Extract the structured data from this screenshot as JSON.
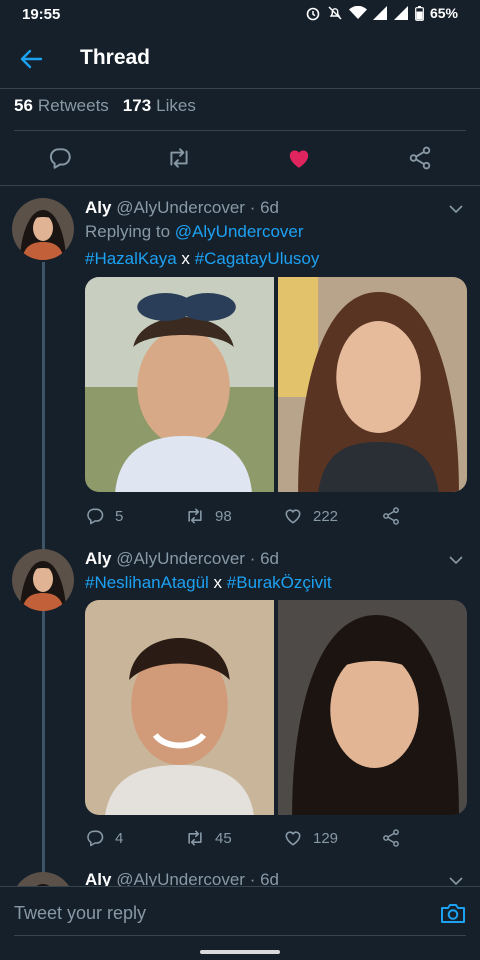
{
  "status_bar": {
    "time": "19:55",
    "battery": "65%"
  },
  "header": {
    "title": "Thread"
  },
  "stats": {
    "retweets_count": "56",
    "retweets_label": "Retweets",
    "likes_count": "173",
    "likes_label": "Likes"
  },
  "colors": {
    "background": "#15202b",
    "accent": "#1da1f2",
    "like": "#e0245e",
    "muted": "#8899a6",
    "divider": "#38444d"
  },
  "tweets": [
    {
      "name": "Aly",
      "handle": "@AlyUndercover",
      "time": "· 6d",
      "replying_label": "Replying to",
      "replying_to": "@AlyUndercover",
      "hashtag_1": "#HazalKaya",
      "separator": "x",
      "hashtag_2": "#CagatayUlusoy",
      "replies": "5",
      "retweets": "98",
      "likes": "222"
    },
    {
      "name": "Aly",
      "handle": "@AlyUndercover",
      "time": "· 6d",
      "hashtag_1": "#NeslihanAtagül",
      "separator": "x",
      "hashtag_2": "#BurakÖzçivit",
      "replies": "4",
      "retweets": "45",
      "likes": "129"
    },
    {
      "name": "Aly",
      "handle": "@AlyUndercover",
      "time": "· 6d"
    }
  ],
  "reply_box": {
    "placeholder": "Tweet your reply"
  },
  "icons": [
    "back-arrow-icon",
    "reply-icon",
    "retweet-icon",
    "heart-icon",
    "share-icon",
    "chevron-down-icon",
    "camera-icon"
  ]
}
